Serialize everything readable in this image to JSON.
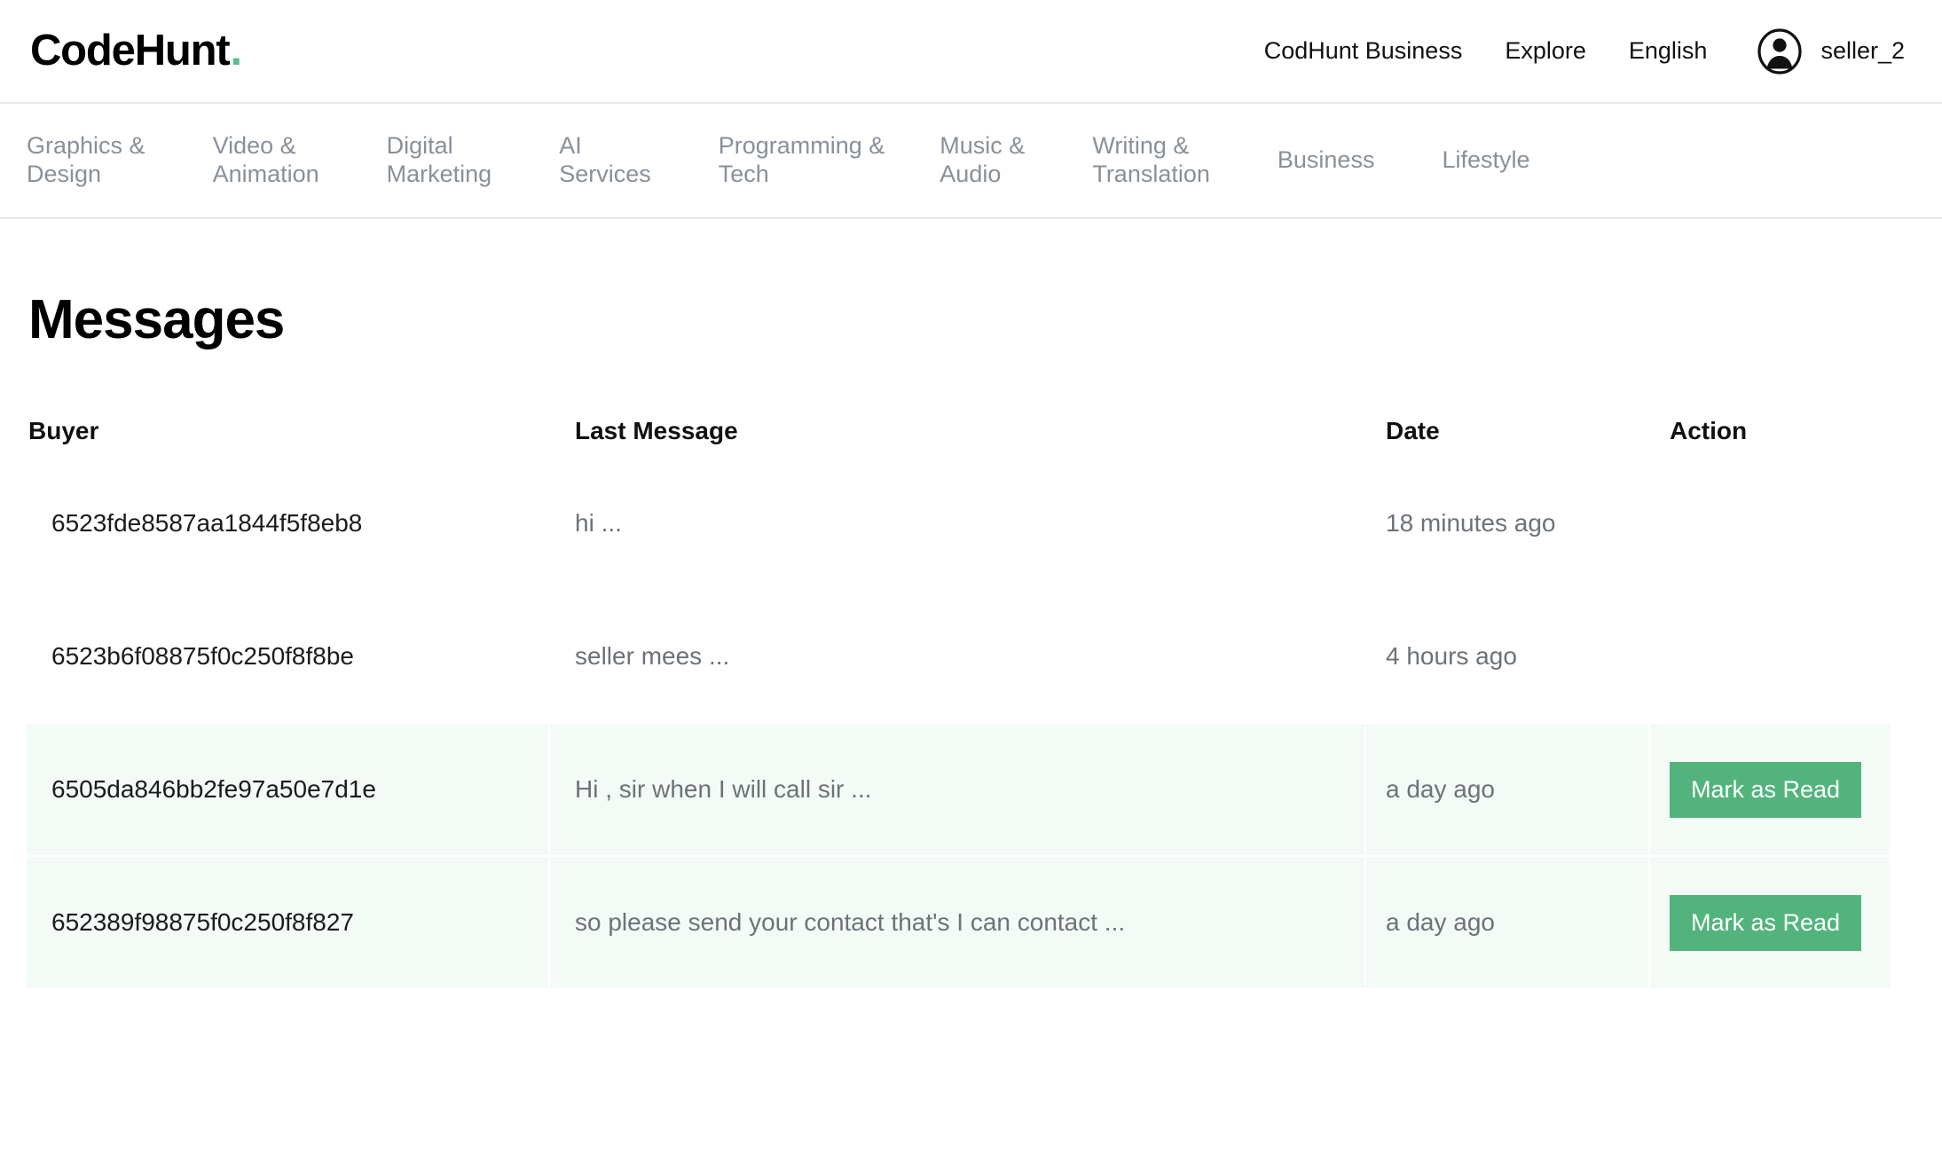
{
  "header": {
    "brand_name": "CodeHunt",
    "brand_dot": ".",
    "links": [
      {
        "label": "CodHunt Business",
        "name": "business"
      },
      {
        "label": "Explore",
        "name": "explore"
      },
      {
        "label": "English",
        "name": "language"
      }
    ],
    "user": {
      "username": "seller_2",
      "avatar_icon": "user-avatar-icon"
    }
  },
  "category_nav": {
    "items": [
      {
        "label": "Graphics &\nDesign"
      },
      {
        "label": "Video &\nAnimation"
      },
      {
        "label": "Digital\nMarketing"
      },
      {
        "label": "AI\nServices"
      },
      {
        "label": "Programming &\nTech"
      },
      {
        "label": "Music &\nAudio"
      },
      {
        "label": "Writing &\nTranslation"
      },
      {
        "label": "Business"
      },
      {
        "label": "Lifestyle"
      }
    ]
  },
  "main": {
    "page_title": "Messages",
    "table": {
      "columns": [
        "Buyer",
        "Last Message",
        "Date",
        "Action"
      ],
      "rows": [
        {
          "buyer": "6523fde8587aa1844f5f8eb8",
          "last_message": "hi ...",
          "date": "18 minutes ago",
          "action_label": "",
          "unread": false
        },
        {
          "buyer": "6523b6f08875f0c250f8f8be",
          "last_message": "seller mees ...",
          "date": "4 hours ago",
          "action_label": "",
          "unread": false
        },
        {
          "buyer": "6505da846bb2fe97a50e7d1e",
          "last_message": "Hi , sir when I will call sir ...",
          "date": "a day ago",
          "action_label": "Mark as Read",
          "unread": true
        },
        {
          "buyer": "652389f98875f0c250f8f827",
          "last_message": "so please send your contact that's I can contact ...",
          "date": "a day ago",
          "action_label": "Mark as Read",
          "unread": true
        }
      ]
    }
  },
  "colors": {
    "brand_dot": "#5bbd8a",
    "button_green": "#52b47c",
    "unread_row": "#f4faf6",
    "muted_text": "#6d7278",
    "nav_text": "#8a9099"
  }
}
